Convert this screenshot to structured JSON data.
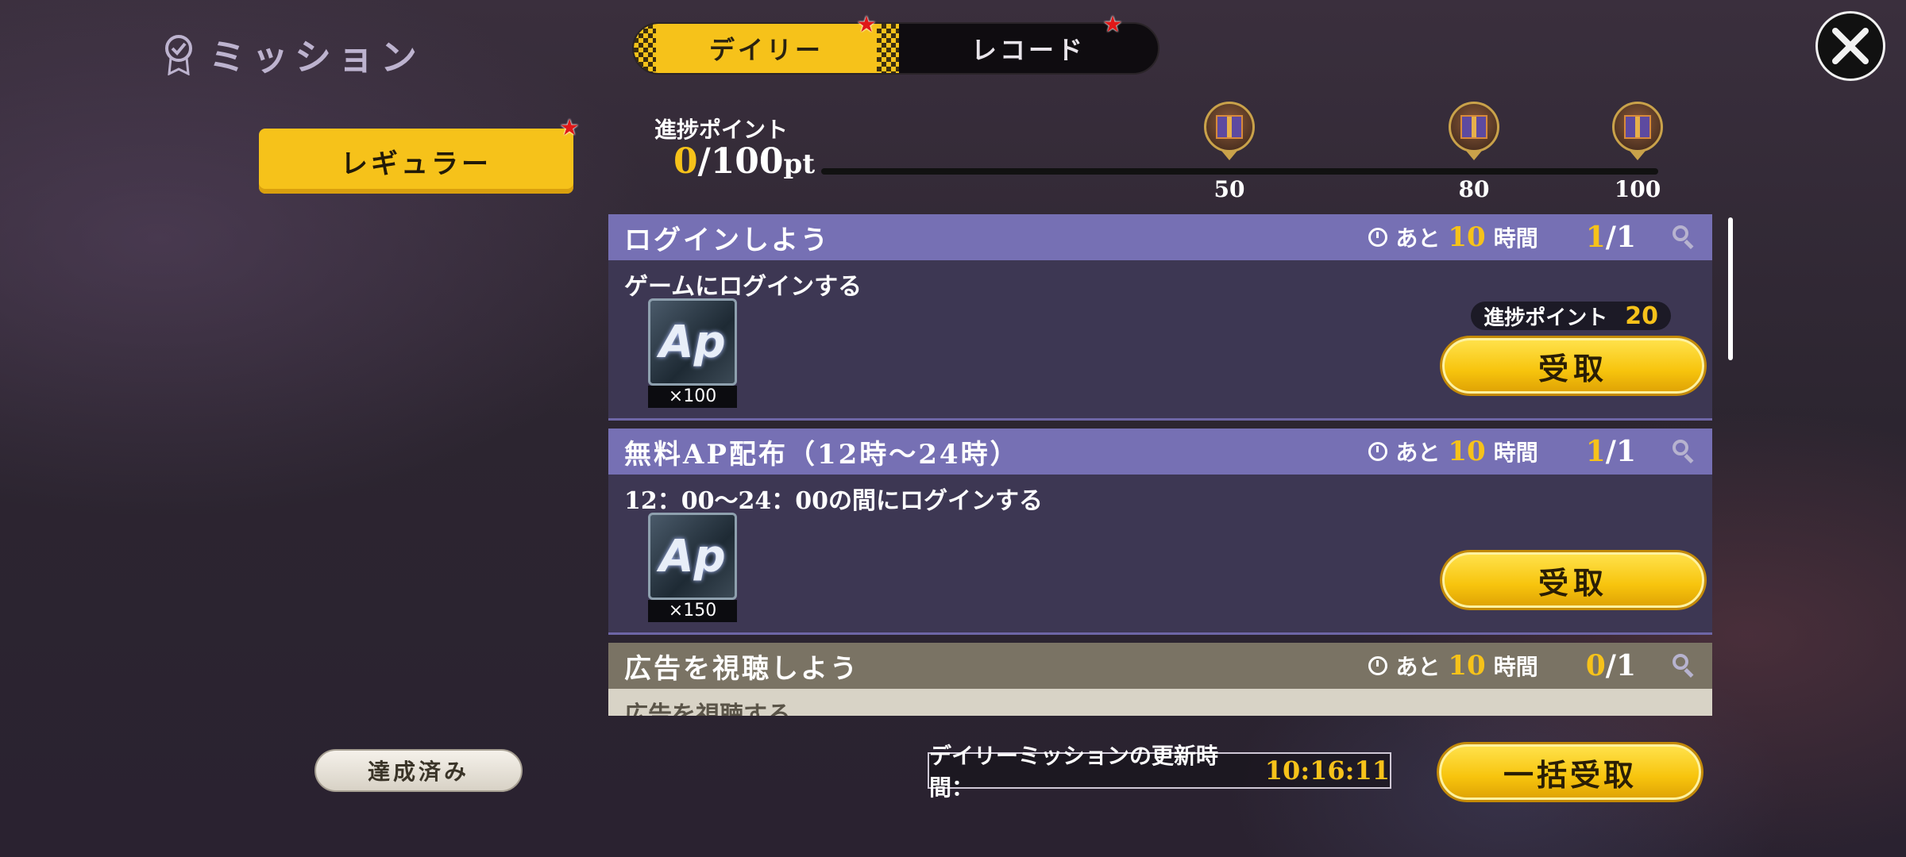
{
  "header": {
    "title": "ミッション",
    "tabs": [
      {
        "label": "デイリー",
        "active": true,
        "badge": "★"
      },
      {
        "label": "レコード",
        "active": false,
        "badge": "★"
      }
    ]
  },
  "sidebar": {
    "categories": [
      {
        "label": "レギュラー",
        "active": true,
        "badge": "★"
      }
    ]
  },
  "progress": {
    "label": "進捗ポイント",
    "current": "0",
    "max_text": "/100",
    "unit": "pt",
    "fraction": 0,
    "milestones": [
      {
        "value": "50"
      },
      {
        "value": "80"
      },
      {
        "value": "100"
      }
    ]
  },
  "missions": [
    {
      "title": "ログインしよう",
      "remaining_prefix": "あと",
      "remaining_hours": "10",
      "remaining_suffix": "時間",
      "count_current": "1",
      "count_total": "/1",
      "description": "ゲームにログインする",
      "reward_icon": "AP",
      "reward_qty": "×100",
      "points_label": "進捗ポイント",
      "points_value": "20",
      "button": "受取"
    },
    {
      "title": "無料AP配布（12時～24時）",
      "remaining_prefix": "あと",
      "remaining_hours": "10",
      "remaining_suffix": "時間",
      "count_current": "1",
      "count_total": "/1",
      "description": "12：00～24：00の間にログインする",
      "reward_icon": "AP",
      "reward_qty": "×150",
      "button": "受取"
    },
    {
      "title": "広告を視聴しよう",
      "remaining_prefix": "あと",
      "remaining_hours": "10",
      "remaining_suffix": "時間",
      "count_current": "0",
      "count_total": "/1",
      "description": "広告を視聴する"
    }
  ],
  "footer": {
    "completed_button": "達成済み",
    "reset_label": "デイリーミッションの更新時間：",
    "reset_time": "10:16:11",
    "bulk_claim_button": "一括受取"
  },
  "colors": {
    "accent": "#f6c21a",
    "card_header": "#7670b4",
    "card_body": "#3d3753",
    "disabled_header": "#7a7364"
  }
}
